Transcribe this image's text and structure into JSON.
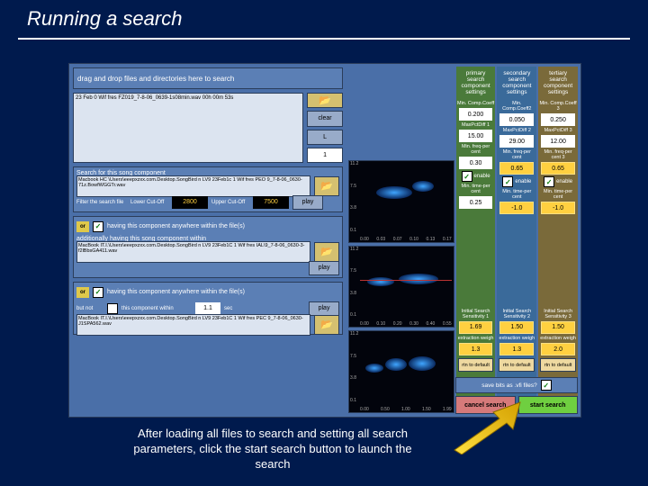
{
  "title": "Running a search",
  "caption": "After loading all files to search and setting all search parameters, click the start search button to launch the search",
  "dropzone": "drag and drop files and directories here to search",
  "filelist_line1": "23 Feb 0 Wif fres   FZ019_7-8-06_0639-1s08min.wav   00h 00m 53s",
  "side_buttons": {
    "clear": "clear",
    "L": "L",
    "num": "1"
  },
  "comp1": {
    "header": "Search for this song component",
    "path": "Macbook HC \\Users\\eeepxzxx.com.Desktop.SongBird n LV9 23Feb1c 1 Wif fres PEO 9_7-8-06_0630-71z.BowfWGGTr.wav",
    "filter": "Filter the search file",
    "lower": "Lower Cut-Off",
    "upper": "Upper Cut-Off",
    "lo": "2800",
    "hi": "7500",
    "play": "play"
  },
  "comp2": {
    "or": "or",
    "having": "having this component anywhere within the file(s)",
    "label": "additionally having this song component within",
    "path": "MacBook IT.I.\\Users\\eeepxzxx.com.Desktop.SongBird n LV9 23Feb1C 1 Wif fres IAL\\9_7-8-06_0630-3-f2lBbsGA411.wav",
    "play": "play"
  },
  "comp3": {
    "or": "or",
    "having": "having this component anywhere within the file(s)",
    "butnot": "but not",
    "thiswithin": "this component within",
    "sec": "sec",
    "num": "1.1",
    "path": "MacBook IT.I.\\Users\\eeepxzxx.com.Desktop.SongBird n LV9 23Feb1C 1 Wif fres PEC 9_7-8-06_0630-J1SPA562.wav",
    "play": "play"
  },
  "spec": {
    "y": [
      "11.2",
      "7.5",
      "3.8",
      "0.1"
    ],
    "x1": [
      "0.00",
      "0.03",
      "0.07",
      "0.10",
      "0.13",
      "0.17"
    ],
    "x2": [
      "0.00",
      "0.10",
      "0.20",
      "0.30",
      "0.40",
      "0.55"
    ],
    "x3": [
      "0.00",
      "0.50",
      "1.00",
      "1.50",
      "1.99"
    ]
  },
  "cols": {
    "c1": {
      "hd": "primary search component settings",
      "r1": "Min. Comp.Coeff",
      "v1": "0.200",
      "r2": "MaxPctDiff 1",
      "v2": "15.00",
      "r3": "Min. freq-per cent",
      "v3": "0.30",
      "en": "enable",
      "r4": "Min. time-per cent",
      "v4": "0.25",
      "r5": "Initial Search Sensitivity 1",
      "v5": "1.69",
      "r6": "extraction weigh",
      "v6": "1.3",
      "def": "rtn to default"
    },
    "c2": {
      "hd": "secondary search component settings",
      "r1": "Min. Comp.Coeff2",
      "v1": "0.050",
      "r2": "MaxPctDiff 2",
      "v2": "29.00",
      "r3": "Min. freq-per cent",
      "v3": "0.65",
      "en": "enable",
      "r4": "Min. time-per cent",
      "v4": "-1.0",
      "r5": "Initial Search Sensitivity 2",
      "v5": "1.50",
      "r6": "extraction weigh",
      "v6": "1.3",
      "def": "rtn to default"
    },
    "c3": {
      "hd": "tertiary search component settings",
      "r1": "Min. Comp.Coeff 3",
      "v1": "0.250",
      "r2": "MaxPctDiff 3",
      "v2": "12.00",
      "r3": "Min. freq-per cent 3",
      "v3": "0.65",
      "en": "enable",
      "r4": "Min. time-per cent",
      "v4": "-1.0",
      "r5": "Initial Search Sensitivity 3",
      "v5": "1.50",
      "r6": "extraction weigh",
      "v6": "2.0",
      "def": "rtn to default"
    }
  },
  "savebits": "save bits as .vfi files?",
  "cancel": "cancel search",
  "start": "start search"
}
